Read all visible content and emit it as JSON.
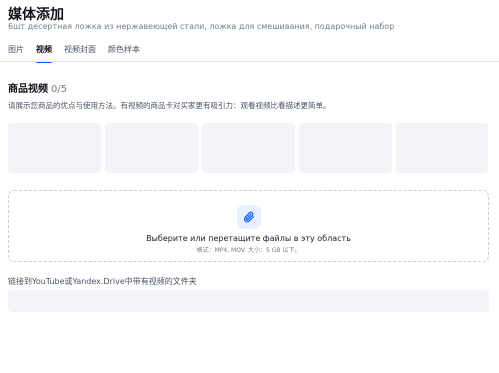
{
  "header": {
    "title": "媒体添加",
    "subtitle": "6шт десертная ложка из нержавеющей стали, ложка для смешивания, подарочный набор"
  },
  "tabs": [
    {
      "label": "图片",
      "active": false
    },
    {
      "label": "视频",
      "active": true
    },
    {
      "label": "视频封面",
      "active": false
    },
    {
      "label": "颜色样本",
      "active": false
    }
  ],
  "section": {
    "title": "商品视频",
    "count": "0/5",
    "description": "请展示您商品的优点与使用方法。有视频的商品卡对买家更有吸引力：观看视频比看描述更简单。"
  },
  "dropzone": {
    "icon": "paperclip-icon",
    "main_text": "Выберите или перетащите файлы в эту область",
    "sub_text": "格式：MP4, MOV. 大小：5 GB 以下。"
  },
  "link": {
    "label": "链接到YouTube或Yandex.Drive中带有视频的文件夹",
    "value": ""
  },
  "colors": {
    "accent": "#005bff",
    "slot_bg": "#f2f4f7",
    "icon_bg": "#eaf0ff"
  }
}
